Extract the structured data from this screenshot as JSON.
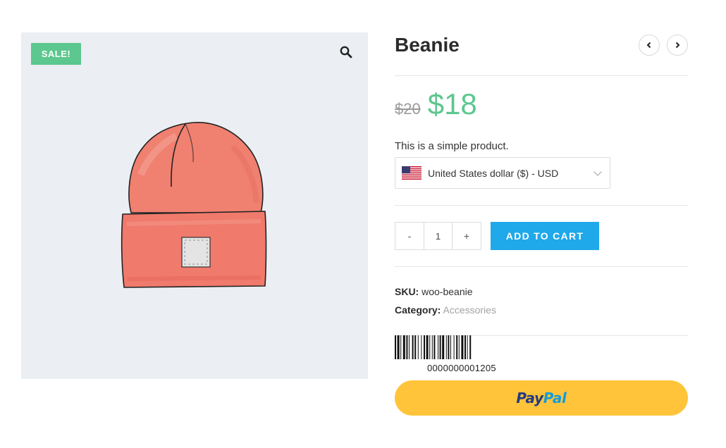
{
  "gallery": {
    "sale_badge": "SALE!",
    "zoom_icon": "magnifier-icon",
    "image_subject": "beanie-image"
  },
  "product": {
    "title": "Beanie",
    "price_old": "$20",
    "price_new": "$18",
    "description": "This is a simple product.",
    "price_new_color": "#5cc78f"
  },
  "nav": {
    "prev_icon": "chevron-left-icon",
    "next_icon": "chevron-right-icon"
  },
  "currency": {
    "selected": "United States dollar ($) - USD",
    "flag_icon": "us-flag-icon"
  },
  "cart": {
    "minus_label": "-",
    "quantity": "1",
    "plus_label": "+",
    "add_label": "ADD TO CART",
    "button_color": "#1fa8ea"
  },
  "meta": {
    "sku_label": "SKU:",
    "sku_value": "woo-beanie",
    "category_label": "Category:",
    "category_value": "Accessories"
  },
  "barcode": {
    "number": "0000000001205"
  },
  "paypal": {
    "logo_part1": "Pay",
    "logo_part2": "Pal",
    "button_color": "#ffc439"
  }
}
